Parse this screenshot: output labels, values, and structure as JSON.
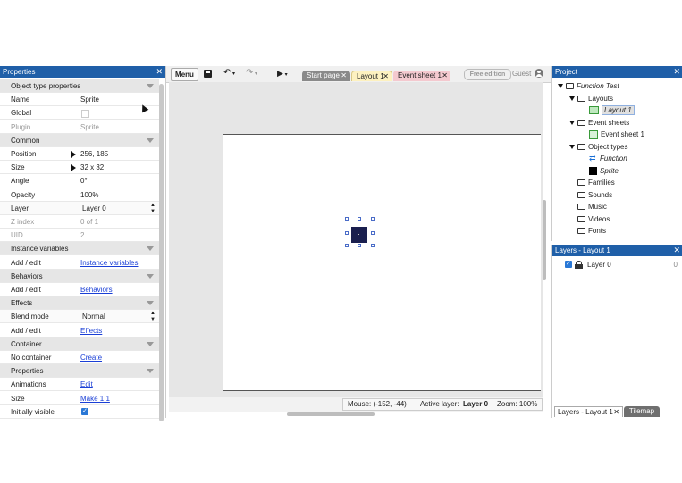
{
  "properties": {
    "title": "Properties",
    "close": "✕",
    "rows": [
      {
        "type": "section",
        "key": "Object type properties"
      },
      {
        "type": "row",
        "key": "Name",
        "value": "Sprite"
      },
      {
        "type": "row",
        "key": "Global",
        "value": ""
      },
      {
        "type": "row",
        "key": "Plugin",
        "value": "Sprite",
        "muted": true
      },
      {
        "type": "section",
        "key": "Common"
      },
      {
        "type": "row",
        "key": "Position",
        "value": "256, 185",
        "arrow": true
      },
      {
        "type": "row",
        "key": "Size",
        "value": "32 x 32",
        "arrow": true
      },
      {
        "type": "row",
        "key": "Angle",
        "value": "0°"
      },
      {
        "type": "row",
        "key": "Opacity",
        "value": "100%"
      },
      {
        "type": "row",
        "key": "Layer",
        "value": "Layer 0",
        "select": true
      },
      {
        "type": "row",
        "key": "Z index",
        "value": "0 of 1",
        "muted": true
      },
      {
        "type": "row",
        "key": "UID",
        "value": "2",
        "muted": true
      },
      {
        "type": "section",
        "key": "Instance variables"
      },
      {
        "type": "row",
        "key": "Add / edit",
        "value": "Instance variables",
        "link": true
      },
      {
        "type": "section",
        "key": "Behaviors"
      },
      {
        "type": "row",
        "key": "Add / edit",
        "value": "Behaviors",
        "link": true
      },
      {
        "type": "section",
        "key": "Effects"
      },
      {
        "type": "row",
        "key": "Blend mode",
        "value": "Normal",
        "select": true
      },
      {
        "type": "row",
        "key": "Add / edit",
        "value": "Effects",
        "link": true
      },
      {
        "type": "section",
        "key": "Container"
      },
      {
        "type": "row",
        "key": "No container",
        "value": "Create",
        "link": true
      },
      {
        "type": "section",
        "key": "Properties"
      },
      {
        "type": "row",
        "key": "Animations",
        "value": "Edit",
        "link": true
      },
      {
        "type": "row",
        "key": "Size",
        "value": "Make 1:1",
        "link": true
      },
      {
        "type": "row",
        "key": "Initially visible",
        "value": "",
        "checkbox": true
      }
    ]
  },
  "toolbar": {
    "menu": "Menu",
    "save_icon": "save-icon",
    "undo_icon": "undo-icon",
    "redo_icon": "redo-icon",
    "play_icon": "play-icon",
    "tabs": [
      {
        "label": "Start page",
        "close": "✕"
      },
      {
        "label": "Layout 1",
        "close": "✕"
      },
      {
        "label": "Event sheet 1",
        "close": "✕"
      }
    ],
    "edition": "Free edition",
    "user": "Guest"
  },
  "status": {
    "mouse": "Mouse: (-152, -44)",
    "active_layer_label": "Active layer:",
    "active_layer": "Layer 0",
    "zoom": "Zoom: 100%"
  },
  "project": {
    "title": "Project",
    "close": "✕",
    "items": [
      {
        "label": "Function Test",
        "italic": true,
        "icon": "folder",
        "indent": 0,
        "expanded": true
      },
      {
        "label": "Layouts",
        "icon": "folder",
        "indent": 1,
        "expanded": true
      },
      {
        "label": "Layout 1",
        "icon": "layout",
        "indent": 2,
        "italic": true,
        "selected": true
      },
      {
        "label": "Event sheets",
        "icon": "folder",
        "indent": 1,
        "expanded": true
      },
      {
        "label": "Event sheet 1",
        "icon": "eventsheet",
        "indent": 2
      },
      {
        "label": "Object types",
        "icon": "folder",
        "indent": 1,
        "expanded": true
      },
      {
        "label": "Function",
        "icon": "function",
        "indent": 2,
        "italic": true
      },
      {
        "label": "Sprite",
        "icon": "sprite",
        "indent": 2,
        "italic": true
      },
      {
        "label": "Families",
        "icon": "folder",
        "indent": 1
      },
      {
        "label": "Sounds",
        "icon": "folder",
        "indent": 1
      },
      {
        "label": "Music",
        "icon": "folder",
        "indent": 1
      },
      {
        "label": "Videos",
        "icon": "folder",
        "indent": 1
      },
      {
        "label": "Fonts",
        "icon": "folder",
        "indent": 1
      }
    ]
  },
  "layers": {
    "title": "Layers - Layout 1",
    "close": "✕",
    "items": [
      {
        "label": "Layer 0",
        "count": "0"
      }
    ],
    "bottom_tabs": [
      {
        "label": "Layers - Layout 1",
        "close": "✕"
      },
      {
        "label": "Tilemap"
      }
    ]
  },
  "colors": {
    "accent": "#1f5fa8",
    "layout_tab": "#fdf1c0",
    "event_tab": "#f4c9cf",
    "sprite": "#1a1f4e"
  }
}
